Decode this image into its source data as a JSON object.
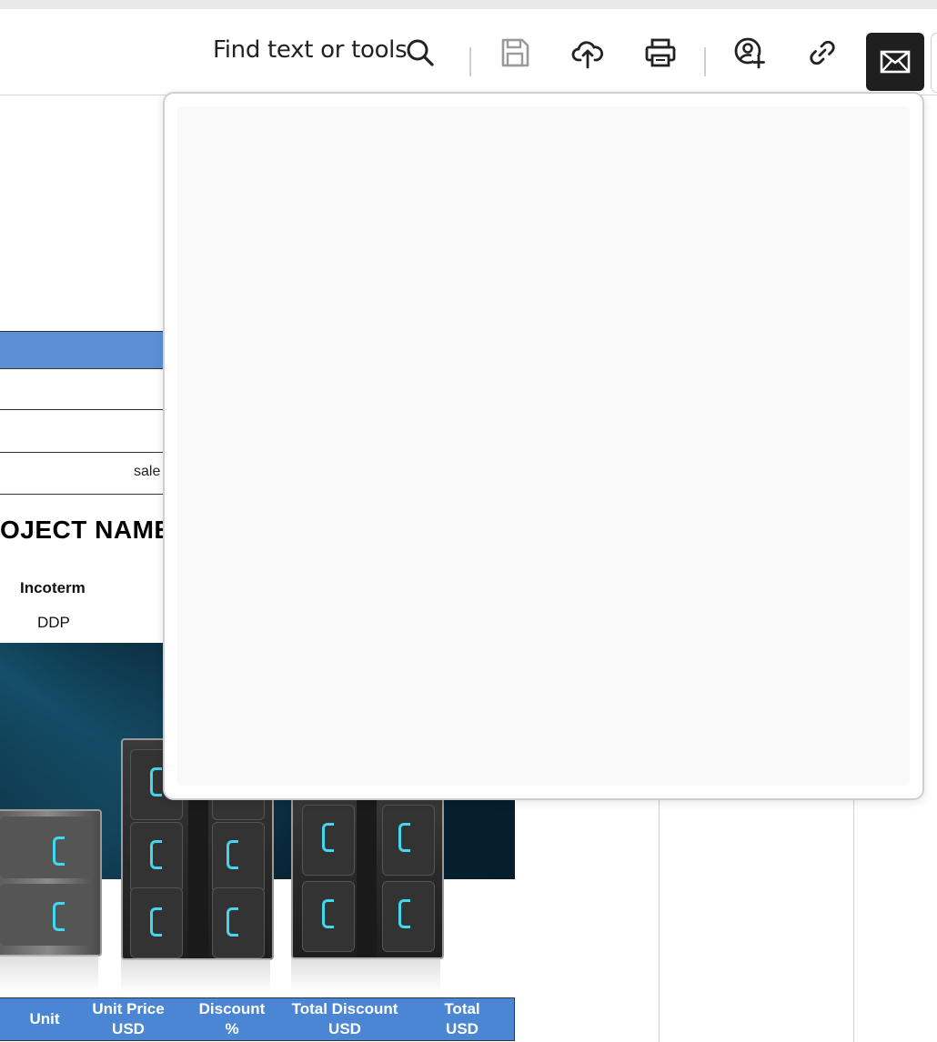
{
  "toolbar": {
    "find_label": "Find text or tools",
    "icons": [
      "search-icon",
      "save-icon",
      "upload-cloud-icon",
      "print-icon",
      "add-user-icon",
      "link-icon",
      "email-icon"
    ]
  },
  "document": {
    "sale_fragment": "sale",
    "project_heading": "OJECT NAME",
    "incoterm_label": "Incoterm",
    "incoterm_value": "DDP",
    "table_headers": [
      {
        "line1": "Unit",
        "line2": ""
      },
      {
        "line1": "Unit Price",
        "line2": "USD"
      },
      {
        "line1": "Discount",
        "line2": "%"
      },
      {
        "line1": "Total Discount",
        "line2": "USD"
      },
      {
        "line1": "Total",
        "line2": "USD"
      }
    ]
  },
  "popup": {
    "state": "blank"
  },
  "colors": {
    "table_header_blue": "#4a86d4",
    "row_blue": "#5b8fd6",
    "email_button_bg": "#1f1f1f",
    "led_accent": "#44d6ee"
  }
}
